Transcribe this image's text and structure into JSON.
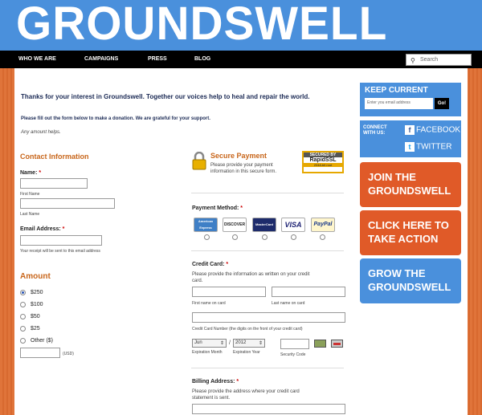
{
  "header": {
    "logo": "GROUNDSWELL"
  },
  "nav": {
    "items": [
      "WHO WE ARE",
      "CAMPAIGNS",
      "PRESS",
      "BLOG"
    ],
    "search_placeholder": "Search"
  },
  "intro": {
    "thanks": "Thanks for your interest in Groundswell. Together our voices help to heal and repair the world.",
    "instructions": "Please fill out the form below to make a donation. We are grateful for your support.",
    "any_amount": "Any amount helps."
  },
  "contact": {
    "heading": "Contact Information",
    "name_label": "Name:",
    "first_name": "First Name",
    "last_name": "Last Name",
    "email_label": "Email Address:",
    "email_note": "Your receipt will be sent to this email address"
  },
  "amount": {
    "heading": "Amount",
    "options": [
      "$250",
      "$100",
      "$50",
      "$25",
      "Other ($)"
    ],
    "selected": "$250",
    "usd": "(USD)"
  },
  "secure": {
    "heading": "Secure Payment",
    "text": "Please provide your payment information in this secure form.",
    "badge_top": "SECURED BY",
    "badge_brand": "RapidSSL",
    "badge_bits": "2048-bit root"
  },
  "payment": {
    "label": "Payment Method:",
    "cards": [
      "American Express",
      "DISCOVER",
      "MasterCard",
      "VISA",
      "PayPal"
    ]
  },
  "credit_card": {
    "label": "Credit Card:",
    "desc": "Please provide the information as written on your credit card.",
    "first_name": "First name on card",
    "last_name": "Last name on card",
    "number_note": "Credit Card Number (the digits on the front of your credit card)",
    "month": "Jun",
    "slash": "/",
    "year": "2012",
    "month_label": "Expiration Month",
    "year_label": "Expiration Year",
    "security_label": "Security Code"
  },
  "billing": {
    "label": "Billing Address:",
    "desc": "Please provide the address where your credit card statement is sent."
  },
  "sidebar": {
    "keep_current": "KEEP CURRENT",
    "email_placeholder": "Enter you email address",
    "go": "Go!",
    "connect": "CONNECT WITH US:",
    "facebook": "FACEBOOK",
    "twitter": "TWITTER",
    "cta_join": "JOIN THE GROUNDSWELL",
    "cta_action": "CLICK HERE TO TAKE ACTION",
    "cta_grow": "GROW THE GROUNDSWELL"
  },
  "colors": {
    "blue": "#4a90dc",
    "orange": "#e0743a",
    "cta_orange": "#e05a28",
    "heading_orange": "#c8661b"
  },
  "required_mark": "*"
}
